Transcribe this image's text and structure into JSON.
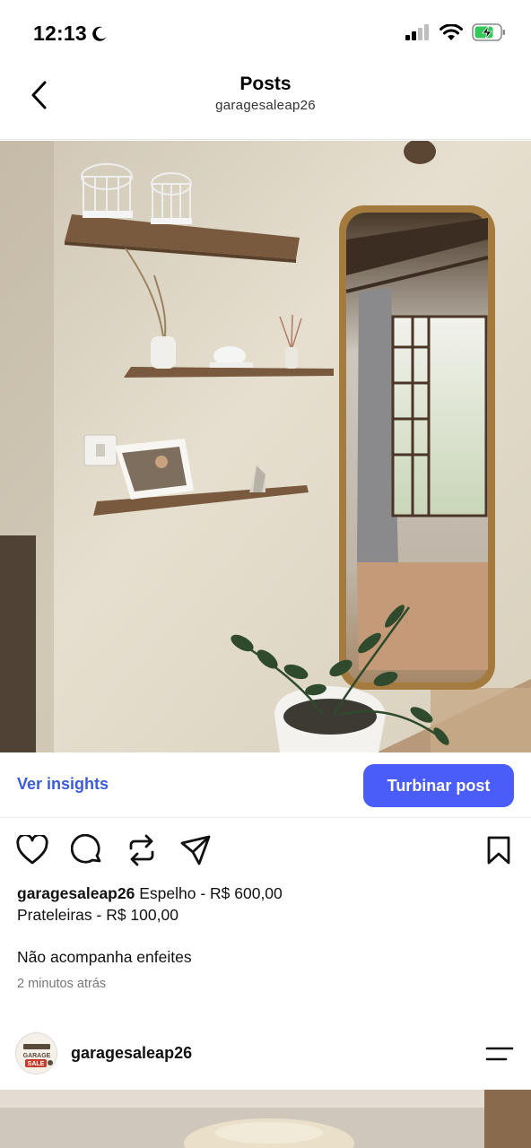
{
  "status_bar": {
    "time": "12:13",
    "icons": [
      "moon-icon",
      "signal-icon",
      "wifi-icon",
      "battery-charging-icon"
    ]
  },
  "header": {
    "title": "Posts",
    "subtitle": "garagesaleap26",
    "back_icon": "chevron-left-icon"
  },
  "post": {
    "image_alt": "Room with wooden floating shelves and a tall gold-framed mirror",
    "insights_label": "Ver insights",
    "boost_label": "Turbinar post",
    "actions": [
      "heart-icon",
      "comment-icon",
      "repost-icon",
      "share-icon",
      "bookmark-icon"
    ],
    "caption_user": "garagesaleap26",
    "caption_text": "Espelho - R$ 600,00",
    "caption_line2": "Prateleiras - R$ 100,00",
    "caption_note": "Não acompanha enfeites",
    "timestamp": "2 minutos atrás"
  },
  "next_post": {
    "username": "garagesaleap26",
    "avatar_text": "GARAGE SALE",
    "menu_icon": "menu-icon"
  },
  "colors": {
    "accent": "#4a5df9",
    "link": "#3a5bdc",
    "battery": "#34c759"
  }
}
